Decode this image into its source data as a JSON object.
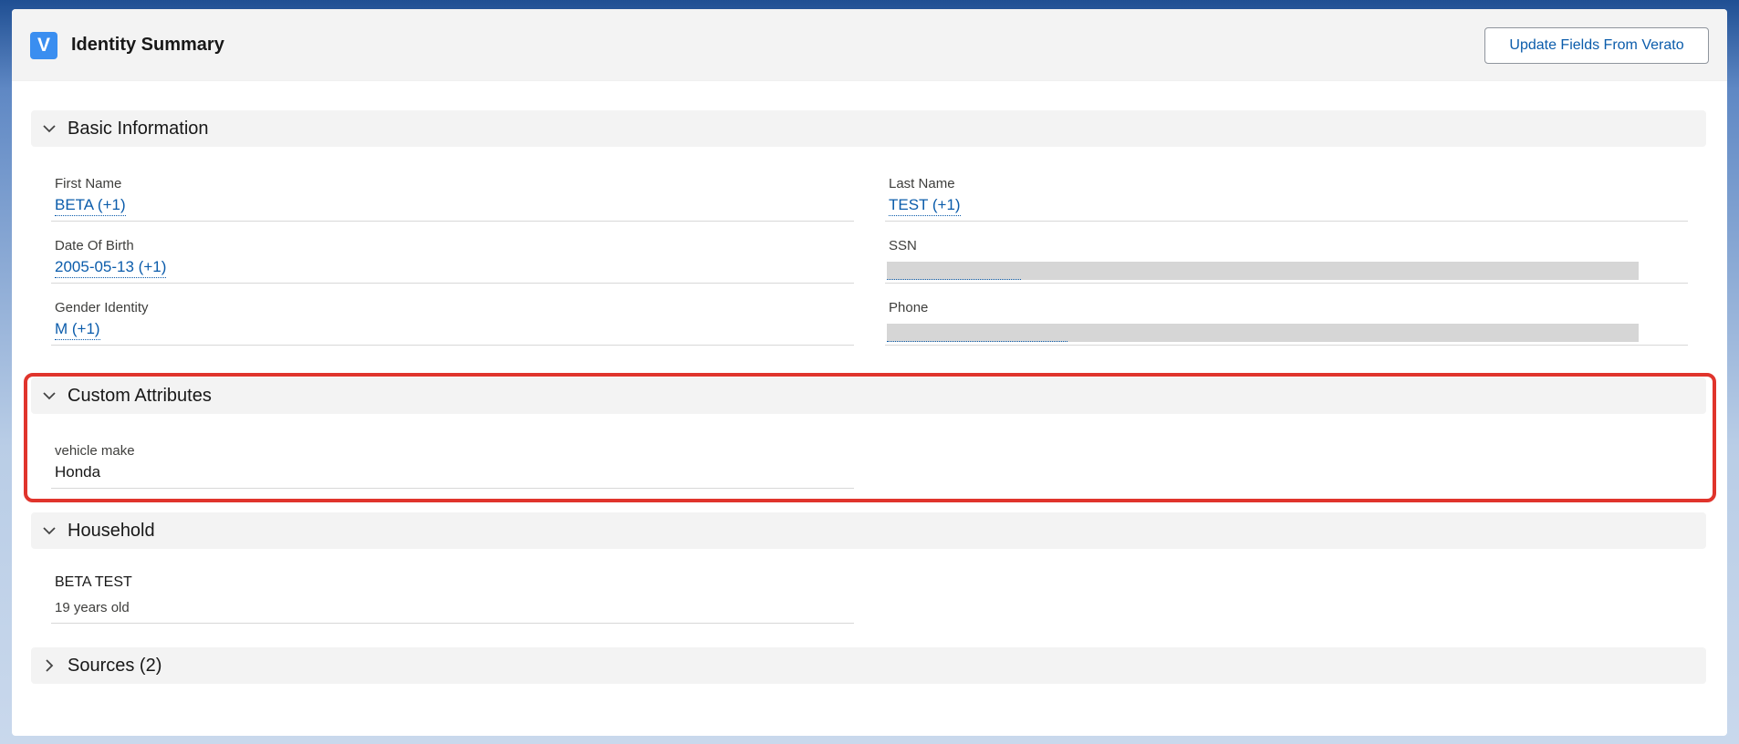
{
  "header": {
    "logo_letter": "V",
    "title": "Identity Summary",
    "update_button_label": "Update Fields From Verato"
  },
  "sections": {
    "basic": {
      "title": "Basic Information",
      "first_name_label": "First Name",
      "first_name_value": "BETA (+1)",
      "last_name_label": "Last Name",
      "last_name_value": "TEST (+1)",
      "dob_label": "Date Of Birth",
      "dob_value": "2005-05-13 (+1)",
      "ssn_label": "SSN",
      "gender_label": "Gender Identity",
      "gender_value": "M (+1)",
      "phone_label": "Phone"
    },
    "custom": {
      "title": "Custom Attributes",
      "vehicle_label": "vehicle make",
      "vehicle_value": "Honda"
    },
    "household": {
      "title": "Household",
      "member_name": "BETA TEST",
      "member_age": "19 years old"
    },
    "sources": {
      "title": "Sources (2)"
    }
  },
  "colors": {
    "link": "#0b5cab",
    "highlight": "#e0342c",
    "logo": "#3a8ef0"
  },
  "icons": {
    "expanded": "chevron-down-icon",
    "collapsed": "chevron-right-icon"
  }
}
